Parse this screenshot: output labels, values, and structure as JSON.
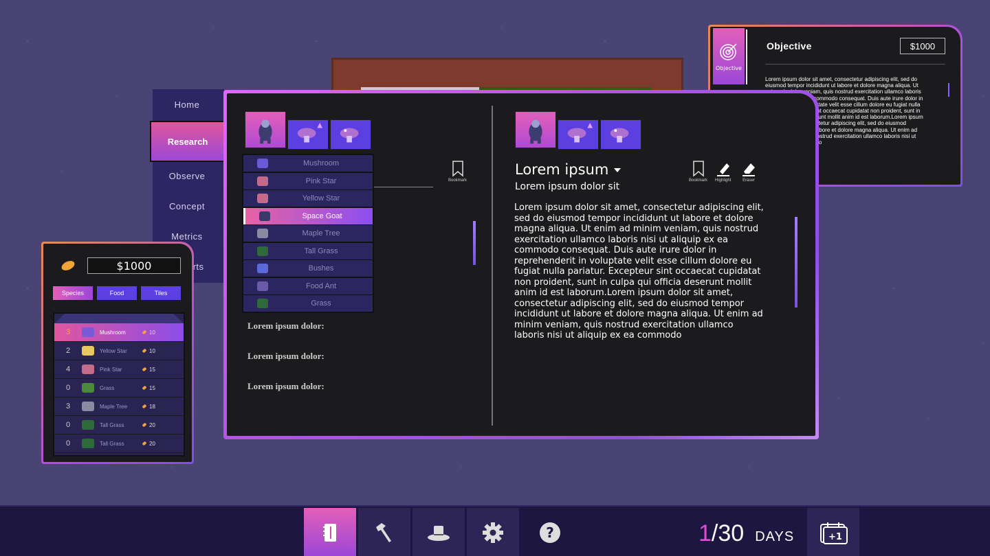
{
  "objective": {
    "tab_label": "Objective",
    "title": "Objective",
    "money": "$1000",
    "text": "Lorem ipsum dolor sit amet, consectetur adipiscing elit, sed do eiusmod tempor incididunt ut labore et dolore magna aliqua. Ut enim ad minim veniam, quis nostrud exercitation ullamco laboris nisi ut aliquip ex ea commodo consequat. Duis aute irure dolor in reprehenderit in voluptate velit esse cillum dolore eu fugiat nulla pariatur. Excepteur sint occaecat cupidatat non proident, sunt in culpa qui officia deserunt mollit anim id est laborum.Lorem ipsum dolor sit amet, consectetur adipiscing elit, sed do eiusmod tempor incididunt ut labore et dolore magna aliqua. Ut enim ad minim veniam, quis nostrud exercitation ullamco laboris nisi ut aliquip ex ea commodo"
  },
  "nav": {
    "items": [
      "Home",
      "Research",
      "Observe",
      "Concept",
      "Metrics",
      "Reports"
    ],
    "active": "Research"
  },
  "inventory": {
    "money": "$1000",
    "tabs": [
      "Species",
      "Food",
      "Tiles"
    ],
    "rows": [
      {
        "qty": "3",
        "name": "Mushroom",
        "cost": "10",
        "color": "#7a5ad8"
      },
      {
        "qty": "2",
        "name": "Yellow Star",
        "cost": "10",
        "color": "#e8c860"
      },
      {
        "qty": "4",
        "name": "Pink Star",
        "cost": "15",
        "color": "#c46a8a"
      },
      {
        "qty": "0",
        "name": "Grass",
        "cost": "15",
        "color": "#4a8a3a"
      },
      {
        "qty": "3",
        "name": "Maple Tree",
        "cost": "18",
        "color": "#8a8aa0"
      },
      {
        "qty": "0",
        "name": "Tall Grass",
        "cost": "20",
        "color": "#2f6a3a"
      },
      {
        "qty": "0",
        "name": "Tall Grass",
        "cost": "20",
        "color": "#2f6a3a"
      }
    ]
  },
  "research": {
    "species": [
      {
        "name": "Mushroom",
        "color": "#6a5ad8"
      },
      {
        "name": "Pink Star",
        "color": "#c46a8a"
      },
      {
        "name": "Yellow Star",
        "color": "#c46a8a"
      },
      {
        "name": "Space Goat",
        "color": "#3a3a6a"
      },
      {
        "name": "Maple Tree",
        "color": "#8a8aa0"
      },
      {
        "name": "Tall Grass",
        "color": "#2f6a3a"
      },
      {
        "name": "Bushes",
        "color": "#5a6ad8"
      },
      {
        "name": "Food Ant",
        "color": "#6a5aa8"
      },
      {
        "name": "Grass",
        "color": "#2f6a3a"
      }
    ],
    "selected": "Space Goat",
    "bookmark_label": "Bookmark",
    "highlight_label": "Highlight",
    "eraser_label": "Eraser",
    "field_labels": [
      "Lorem ipsum dolor:",
      "Lorem ipsum dolor:",
      "Lorem ipsum dolor:"
    ],
    "title": "Lorem ipsum",
    "subtitle": "Lorem ipsum dolor sit",
    "body": "Lorem ipsum dolor sit amet, consectetur adipiscing elit, sed do eiusmod tempor incididunt ut labore et dolore magna aliqua. Ut enim ad minim veniam, quis nostrud exercitation ullamco laboris nisi ut aliquip ex ea commodo consequat. Duis aute irure dolor in reprehenderit in voluptate velit esse cillum dolore eu fugiat nulla pariatur. Excepteur sint occaecat cupidatat non proident, sunt in culpa qui officia deserunt mollit anim id est laborum.Lorem ipsum dolor sit amet, consectetur adipiscing elit, sed do eiusmod tempor incididunt ut labore et dolore magna aliqua. Ut enim ad minim veniam, quis nostrud exercitation ullamco laboris nisi ut aliquip ex ea commodo"
  },
  "bottom_bar": {
    "buttons": [
      "journal-icon",
      "hammer-icon",
      "top-hat-icon",
      "gear-icon",
      "help-icon"
    ],
    "day_current": "1",
    "day_total": "/30",
    "days_label": "DAYS",
    "advance_label": "+1"
  },
  "colors": {
    "accent_pink": "#e35fb9",
    "accent_purple": "#8b4ef0",
    "background": "#4a4474"
  }
}
